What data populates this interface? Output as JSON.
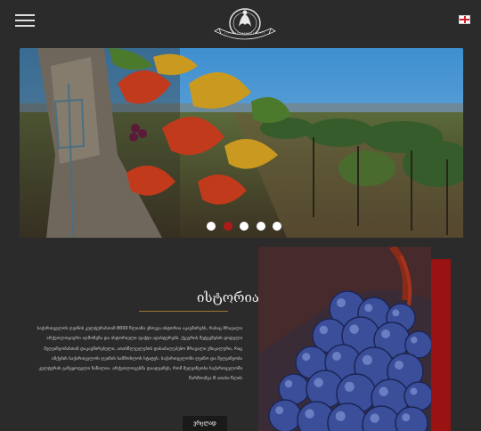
{
  "header": {
    "menu_icon": "hamburger-menu-icon",
    "logo_icon": "winery-crest-logo",
    "language_icon": "english-flag-icon"
  },
  "hero": {
    "slides_count": 5,
    "active_slide": 2,
    "image_icon": "vineyard-photo"
  },
  "history": {
    "title": "ისტორია",
    "text": "საქართველოს ღვინის კულტურასთან 8000 წლიანი ეზოვეა ისტორია აკავშირებს, რასაც მრავალი არქეოლოგიური აღმოჩენა და ისტორიული ფაქტი ადასტურებს. ქვევრის შეტევმების დიდელი მეღვინეობასთან დაკავშირებული, ათასწლეულების დასაბალეპებო მრავალი უნიკალური, რაც ინქების საქართველოს ღვინის სამშობლოს სტატუს. საქართველოში ღვინო და მეღვინეობა კულტურის განეყოფელი ნაწილია. არქეოლოგებმა დაადგინეს, რომ მეღვინეობა საქართველოში წარმოიშვა 8 ათასი წლის",
    "more_button": "ვრცლად"
  },
  "side_image": {
    "image_icon": "blue-grapes-photo",
    "accent_color": "#9a1212"
  }
}
